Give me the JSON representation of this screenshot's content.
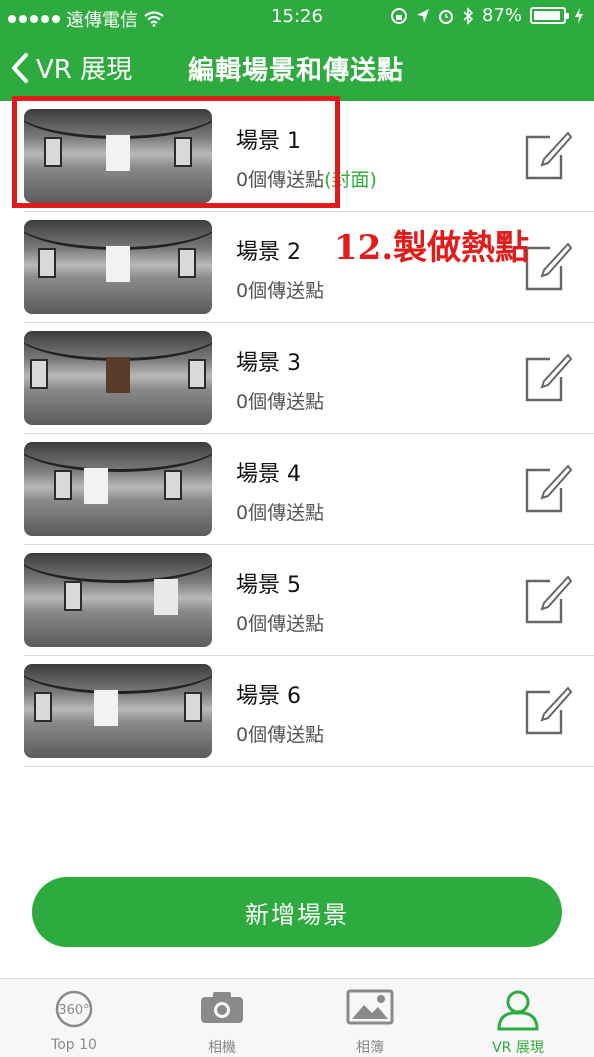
{
  "status_bar": {
    "carrier": "遠傳電信",
    "time": "15:26",
    "battery": "87%"
  },
  "nav": {
    "back_label": "VR 展現",
    "title": "編輯場景和傳送點"
  },
  "scenes": [
    {
      "name": "場景 1",
      "count": "0個傳送點",
      "tag": "(封面)"
    },
    {
      "name": "場景 2",
      "count": "0個傳送點"
    },
    {
      "name": "場景 3",
      "count": "0個傳送點"
    },
    {
      "name": "場景 4",
      "count": "0個傳送點"
    },
    {
      "name": "場景 5",
      "count": "0個傳送點"
    },
    {
      "name": "場景 6",
      "count": "0個傳送點"
    }
  ],
  "annotation": "12.製做熱點",
  "add_button": "新增場景",
  "tabs": [
    {
      "label": "Top 10",
      "icon": "360-icon",
      "icon_text": "360°"
    },
    {
      "label": "相機",
      "icon": "camera-icon"
    },
    {
      "label": "相簿",
      "icon": "album-icon"
    },
    {
      "label": "VR 展現",
      "icon": "person-icon",
      "active": true
    }
  ],
  "colors": {
    "brand": "#2eab3f",
    "annotation": "#e21b1b"
  }
}
